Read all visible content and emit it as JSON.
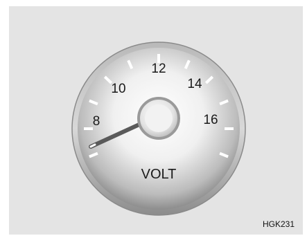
{
  "gauge": {
    "unit_label": "VOLT",
    "scale_labels": [
      "8",
      "10",
      "12",
      "14",
      "16"
    ],
    "min_value": 7,
    "max_value": 17,
    "needle_value": 7,
    "colors": {
      "face_light": "#ffffff",
      "face_dark": "#707070",
      "bezel": "#8a8a8a",
      "ticks": "#ffffff",
      "needle": "#5a5a5a",
      "text": "#1a1a1a"
    }
  },
  "figure_code": "HGK231"
}
